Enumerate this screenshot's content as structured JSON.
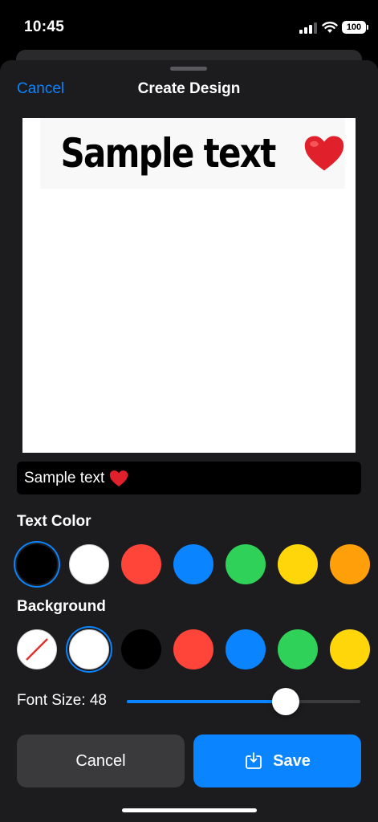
{
  "status_bar": {
    "time": "10:45",
    "battery": "100"
  },
  "nav": {
    "cancel_label": "Cancel",
    "title": "Create Design"
  },
  "preview": {
    "text": "Sample text",
    "emoji": "❤️",
    "text_color": "#000000",
    "background_color": "#FFFFFF"
  },
  "text_field": {
    "value": "Sample text",
    "emoji": "❤️"
  },
  "text_color": {
    "label": "Text Color",
    "selected_index": 0,
    "options": [
      "#000000",
      "#FFFFFF",
      "#FF453A",
      "#0A84FF",
      "#30D158",
      "#FFD60A",
      "#FF9F0A"
    ]
  },
  "background": {
    "label": "Background",
    "selected_index": 1,
    "options": [
      "none",
      "#FFFFFF",
      "#000000",
      "#FF453A",
      "#0A84FF",
      "#30D158",
      "#FFD60A"
    ]
  },
  "font_size": {
    "label": "Font Size: 48",
    "value": 48,
    "fraction": 0.68
  },
  "buttons": {
    "cancel_label": "Cancel",
    "save_label": "Save"
  },
  "icons": {
    "heart": "heart-emoji",
    "save": "tray-arrow-down-icon",
    "wifi": "wifi-icon",
    "signal": "cellular-signal-icon",
    "battery": "battery-icon"
  }
}
